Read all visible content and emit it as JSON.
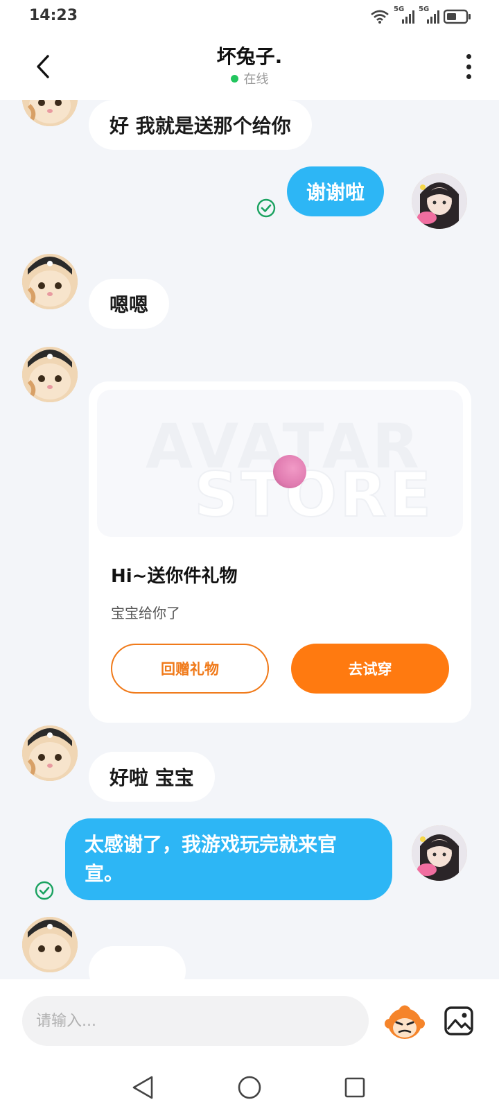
{
  "status_bar": {
    "time": "14:23",
    "icons": [
      "wifi-icon",
      "signal-5g-icon",
      "signal-5g-icon",
      "battery-icon"
    ],
    "network_label_1": "5G",
    "network_label_2": "5G"
  },
  "header": {
    "contact_name": "坏兔子.",
    "status_text": "在线",
    "status_color": "#22c55e"
  },
  "messages": [
    {
      "side": "in",
      "text": "好  我就是送那个给你"
    },
    {
      "side": "out",
      "text": "谢谢啦",
      "read": true
    },
    {
      "side": "in",
      "text": "嗯嗯"
    },
    {
      "side": "in",
      "type": "gift_card",
      "banner_line1": "AVATAR",
      "banner_line2": "STORE",
      "title": "Hi~送你件礼物",
      "subtitle": "宝宝给你了",
      "button_return": "回赠礼物",
      "button_try": "去试穿"
    },
    {
      "side": "in",
      "text": "好啦  宝宝"
    },
    {
      "side": "out",
      "text": "太感谢了，我游戏玩完就来官宣。",
      "read": true
    }
  ],
  "input": {
    "placeholder": "请输入..."
  },
  "colors": {
    "outgoing_bubble": "#2db6f5",
    "accent_orange": "#ff7a10",
    "read_check": "#1aa260"
  }
}
